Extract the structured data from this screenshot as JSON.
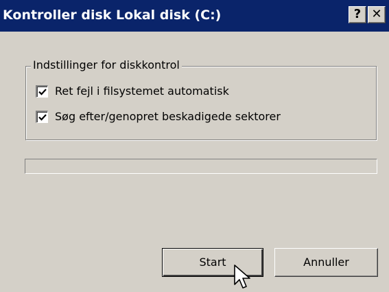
{
  "window": {
    "title": "Kontroller disk Lokal disk (C:)",
    "help_label": "?",
    "close_label": "✕"
  },
  "options": {
    "group_label": "Indstillinger for diskkontrol",
    "items": [
      {
        "label": "Ret fejl i filsystemet automatisk",
        "checked": true
      },
      {
        "label": "Søg efter/genopret beskadigede sektorer",
        "checked": true
      }
    ]
  },
  "progress": {
    "value": 0
  },
  "buttons": {
    "start_label": "Start",
    "cancel_label": "Annuller"
  },
  "colors": {
    "titlebar": "#0a246a",
    "face": "#d4d0c8",
    "title_text": "#ffffff"
  },
  "icons": {
    "checkmark": "check-icon",
    "pointer": "mouse-pointer-icon"
  }
}
